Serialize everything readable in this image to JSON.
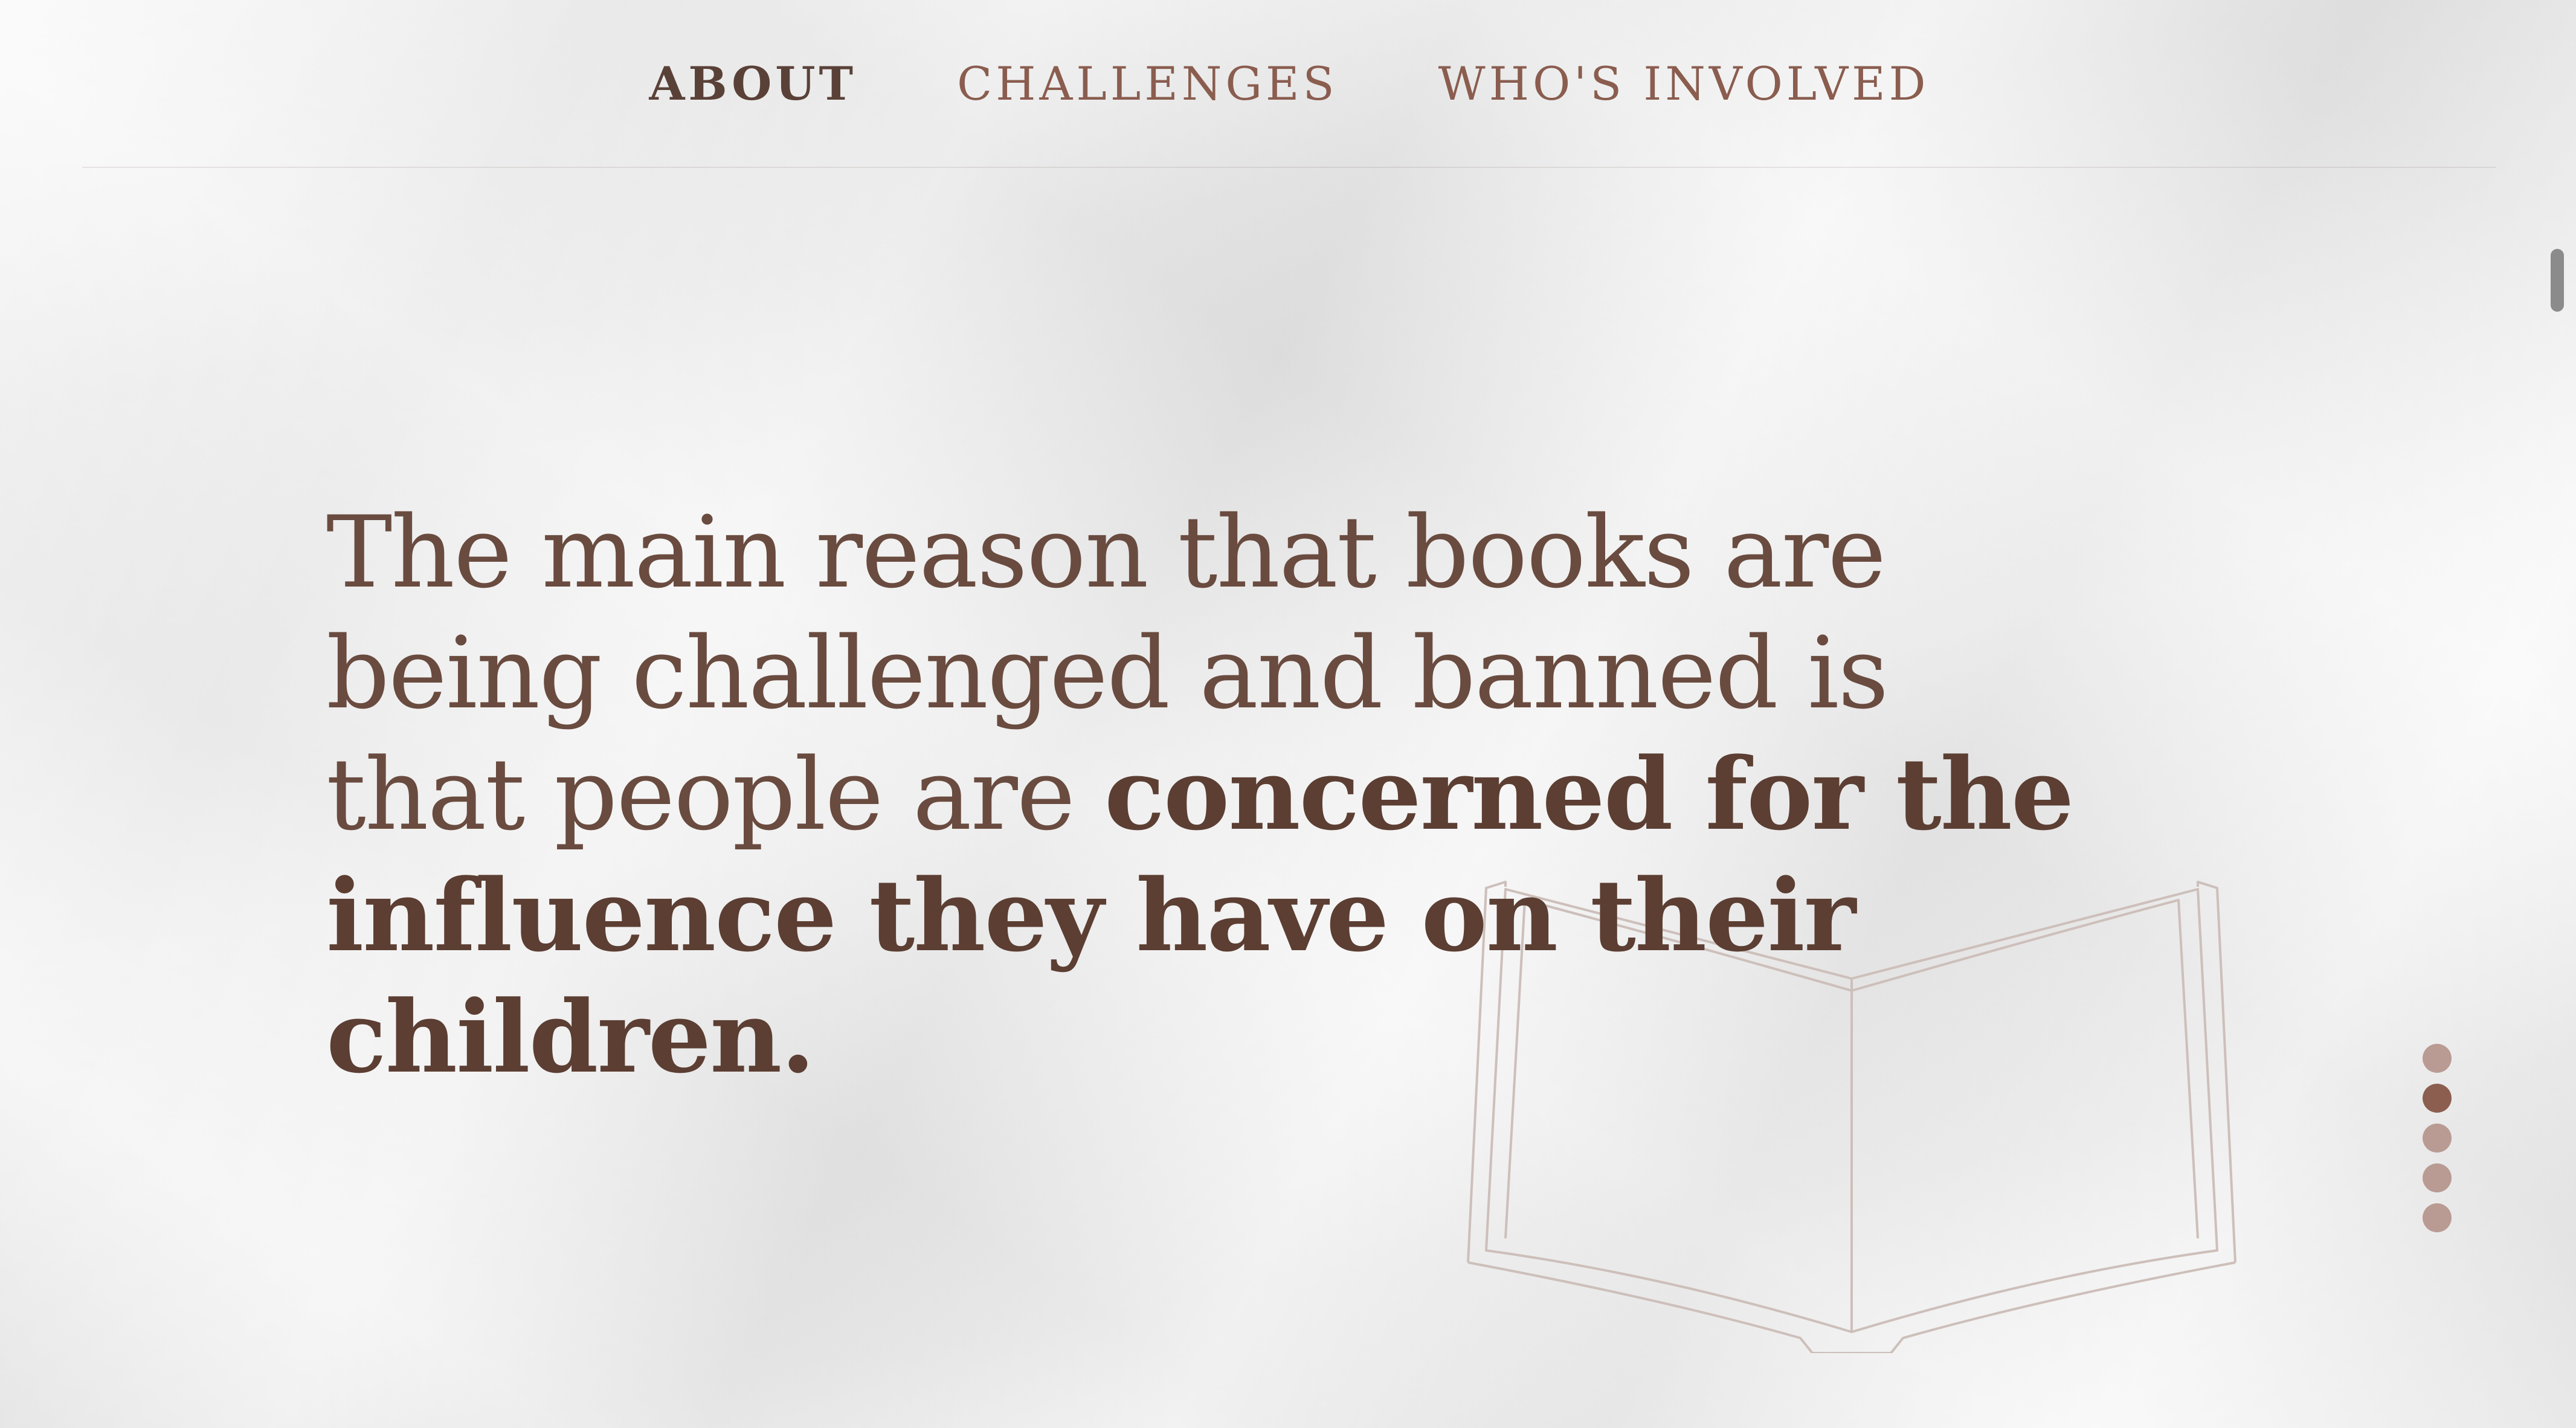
{
  "nav": {
    "items": [
      {
        "label": "ABOUT",
        "active": true
      },
      {
        "label": "CHALLENGES",
        "active": false
      },
      {
        "label": "WHO'S INVOLVED",
        "active": false
      }
    ]
  },
  "hero": {
    "text_regular": "The main reason that books are being challenged and banned is that people are ",
    "text_emphasis": "concerned for the influence they have on their children."
  },
  "section_dots": {
    "count": 5,
    "active_index": 1
  },
  "icons": {
    "illustration": "open-book-icon"
  },
  "colors": {
    "text": "#6a4b3f",
    "nav": "#8a5d4f",
    "dot": "#b99b93",
    "dot_active": "#8c5e4f"
  }
}
